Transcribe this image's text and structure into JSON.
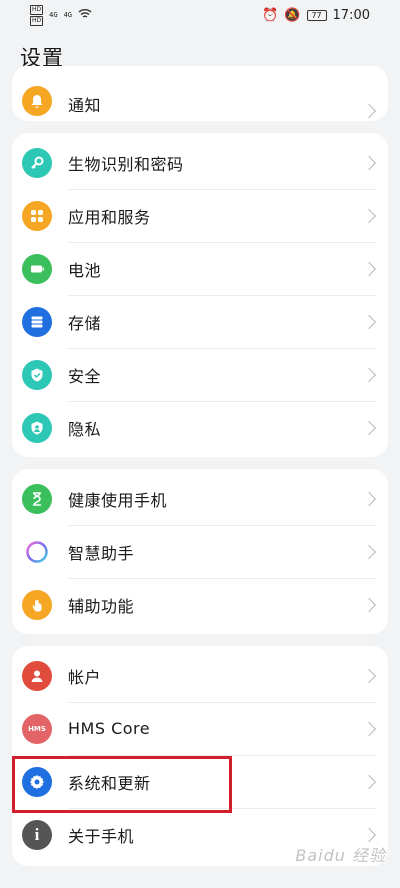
{
  "status": {
    "left": [
      "HD",
      "HD",
      "4G",
      "4G"
    ],
    "battery": "77",
    "time": "17:00"
  },
  "page_title": "设置",
  "groups": [
    {
      "items": [
        {
          "label": "通知",
          "icon": "bell-icon",
          "color": "#f5a623"
        }
      ]
    },
    {
      "items": [
        {
          "label": "生物识别和密码",
          "icon": "key-icon",
          "color": "#2dc7b6"
        },
        {
          "label": "应用和服务",
          "icon": "apps-icon",
          "color": "#f5a623"
        },
        {
          "label": "电池",
          "icon": "battery-icon",
          "color": "#3bbf5d"
        },
        {
          "label": "存储",
          "icon": "storage-icon",
          "color": "#1f6fe0"
        },
        {
          "label": "安全",
          "icon": "shield-icon",
          "color": "#2dc7b6"
        },
        {
          "label": "隐私",
          "icon": "privacy-icon",
          "color": "#2dc7b6"
        }
      ]
    },
    {
      "items": [
        {
          "label": "健康使用手机",
          "icon": "hourglass-icon",
          "color": "#3bbf5d"
        },
        {
          "label": "智慧助手",
          "icon": "assistant-icon",
          "color": "#ffffff"
        },
        {
          "label": "辅助功能",
          "icon": "hand-icon",
          "color": "#f5a623"
        }
      ]
    },
    {
      "items": [
        {
          "label": "帐户",
          "icon": "user-icon",
          "color": "#e14b3b"
        },
        {
          "label": "HMS Core",
          "icon": "hms-icon",
          "color": "#e26466"
        },
        {
          "label": "系统和更新",
          "icon": "gear-icon",
          "color": "#1f6fe0"
        },
        {
          "label": "关于手机",
          "icon": "info-icon",
          "color": "#555555"
        }
      ]
    }
  ],
  "watermark": "Baidu 经验"
}
